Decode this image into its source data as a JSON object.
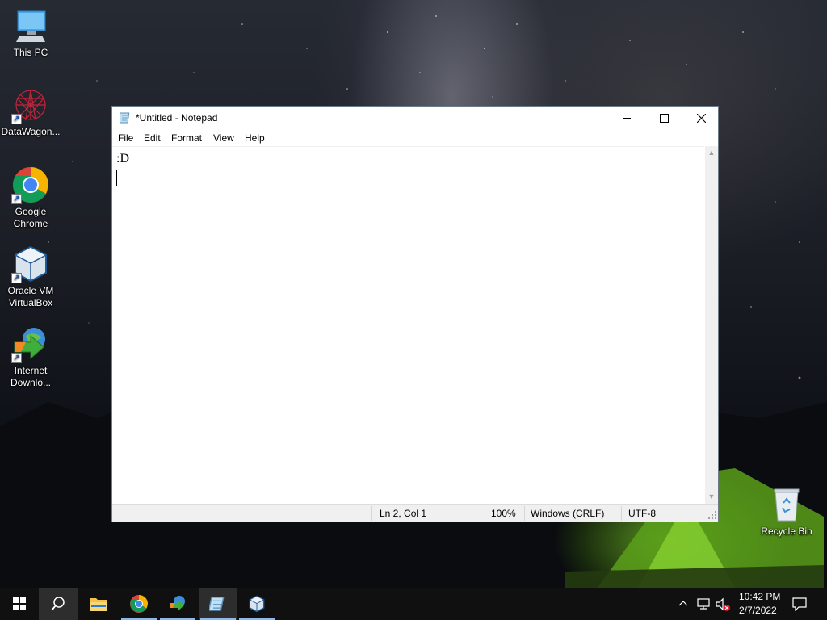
{
  "desktop": {
    "icons": [
      {
        "label_line1": "This PC",
        "label_line2": ""
      },
      {
        "label_line1": "DataWagon...",
        "label_line2": ""
      },
      {
        "label_line1": "Google",
        "label_line2": "Chrome"
      },
      {
        "label_line1": "Oracle VM",
        "label_line2": "VirtualBox"
      },
      {
        "label_line1": "Internet",
        "label_line2": "Downlo..."
      },
      {
        "label_line1": "Recycle Bin",
        "label_line2": ""
      }
    ]
  },
  "notepad": {
    "title": "*Untitled - Notepad",
    "menu": [
      "File",
      "Edit",
      "Format",
      "View",
      "Help"
    ],
    "content_line1": ":D",
    "content_line2": "",
    "status": {
      "position": "Ln 2, Col 1",
      "zoom": "100%",
      "line_ending": "Windows (CRLF)",
      "encoding": "UTF-8"
    }
  },
  "taskbar": {
    "apps": [
      "start",
      "search",
      "file-explorer",
      "chrome",
      "internet-download-manager",
      "notepad",
      "virtualbox"
    ],
    "active_app": "notepad",
    "clock_time": "10:42 PM",
    "clock_date": "2/7/2022"
  },
  "colors": {
    "taskbar": "#101010",
    "tent_glow": "#78c828",
    "active_indicator": "#8fb8e8"
  }
}
